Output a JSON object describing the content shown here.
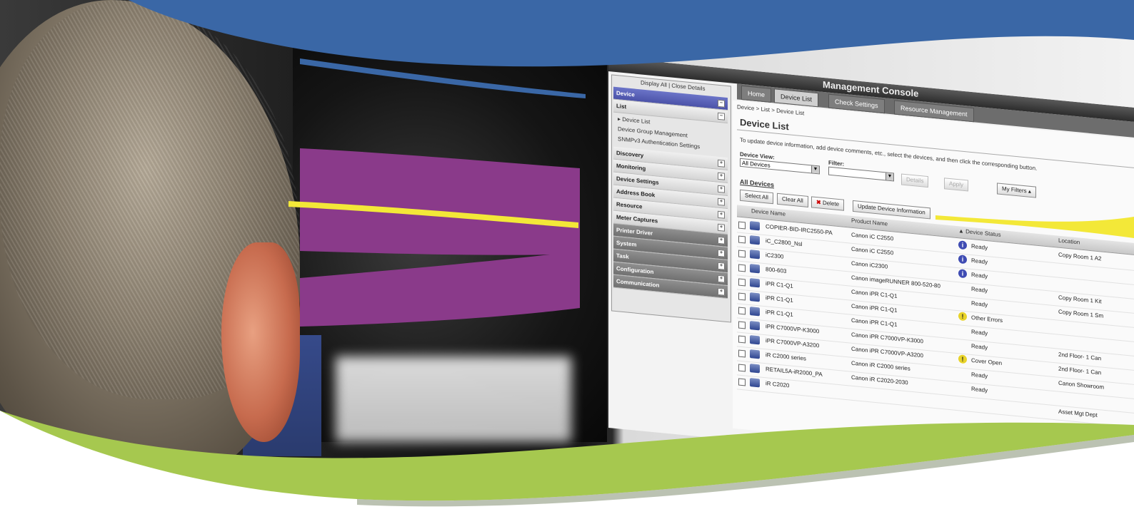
{
  "colors": {
    "top_blue": "#3a67a6",
    "purple": "#8a3a8a",
    "yellow": "#f3e838",
    "green": "#a6c84f"
  },
  "console": {
    "title": "Management Console"
  },
  "tabs": [
    {
      "label": "Home"
    },
    {
      "label": "Device List"
    },
    {
      "label": "Check Settings"
    },
    {
      "label": "Resource Management"
    }
  ],
  "sidebar": {
    "top_link": "Display All | Close Details",
    "items": [
      {
        "label": "Device"
      },
      {
        "label": "List"
      },
      {
        "label": "Discovery"
      },
      {
        "label": "Monitoring"
      },
      {
        "label": "Device Settings"
      },
      {
        "label": "Address Book"
      },
      {
        "label": "Resource"
      },
      {
        "label": "Meter Captures"
      },
      {
        "label": "Printer Driver"
      },
      {
        "label": "System"
      },
      {
        "label": "Task"
      },
      {
        "label": "Configuration"
      },
      {
        "label": "Communication"
      }
    ],
    "sub_items": [
      {
        "label": "Device List"
      },
      {
        "label": "Device Group Management"
      },
      {
        "label": "SNMPv3 Authentication Settings"
      }
    ]
  },
  "main": {
    "breadcrumb": "Device > List > Device List",
    "title": "Device List",
    "instructions": "To update device information, add device comments, etc., select the devices, and then click the corresponding button.",
    "device_view_label": "Device View:",
    "device_view_value": "All Devices",
    "filter_label": "Filter:",
    "filter_value": "",
    "details_button": "Details",
    "apply_button": "Apply",
    "my_filters_button": "My Filters",
    "section_title": "All Devices",
    "select_all_button": "Select All",
    "clear_all_button": "Clear All",
    "delete_button": "Delete",
    "update_button": "Update Device Information",
    "columns": [
      "Device Name",
      "Product Name",
      "Device Status",
      "Location"
    ],
    "rows": [
      {
        "name": "COPIER-BID-IRC2550-PA",
        "product": "Canon iC C2550",
        "status": "Ready",
        "status_icon": "info",
        "location": "Copy Room 1 A2"
      },
      {
        "name": "iC_C2800_Nsl",
        "product": "Canon iC C2550",
        "status": "Ready",
        "status_icon": "info",
        "location": ""
      },
      {
        "name": "iC2300",
        "product": "Canon iC2300",
        "status": "Ready",
        "status_icon": "info",
        "location": ""
      },
      {
        "name": "800-603",
        "product": "Canon imageRUNNER 800-520-80",
        "status": "Ready",
        "status_icon": "",
        "location": "Copy Room 1 Kit"
      },
      {
        "name": "iPR C1-Q1",
        "product": "Canon iPR C1-Q1",
        "status": "Ready",
        "status_icon": "",
        "location": "Copy Room 1 Sm"
      },
      {
        "name": "iPR C1-Q1",
        "product": "Canon iPR C1-Q1",
        "status": "Other Errors",
        "status_icon": "warn",
        "location": ""
      },
      {
        "name": "iPR C1-Q1",
        "product": "Canon iPR C1-Q1",
        "status": "Ready",
        "status_icon": "",
        "location": ""
      },
      {
        "name": "iPR C7000VP-K3000",
        "product": "Canon iPR C7000VP-K3000",
        "status": "Ready",
        "status_icon": "",
        "location": "2nd Floor- 1 Can"
      },
      {
        "name": "iPR C7000VP-A3200",
        "product": "Canon iPR C7000VP-A3200",
        "status": "Cover Open",
        "status_icon": "warn",
        "location": "2nd Floor- 1 Can"
      },
      {
        "name": "iR C2000 series",
        "product": "Canon iR C2000 series",
        "status": "Ready",
        "status_icon": "",
        "location": "Canon Showroom"
      },
      {
        "name": "RETAIL5A-iR2000_PA",
        "product": "Canon iR C2020-2030",
        "status": "Ready",
        "status_icon": "",
        "location": ""
      },
      {
        "name": "iR C2020",
        "product": "",
        "status": "",
        "status_icon": "",
        "location": "Asset Mgt Dept"
      }
    ]
  }
}
